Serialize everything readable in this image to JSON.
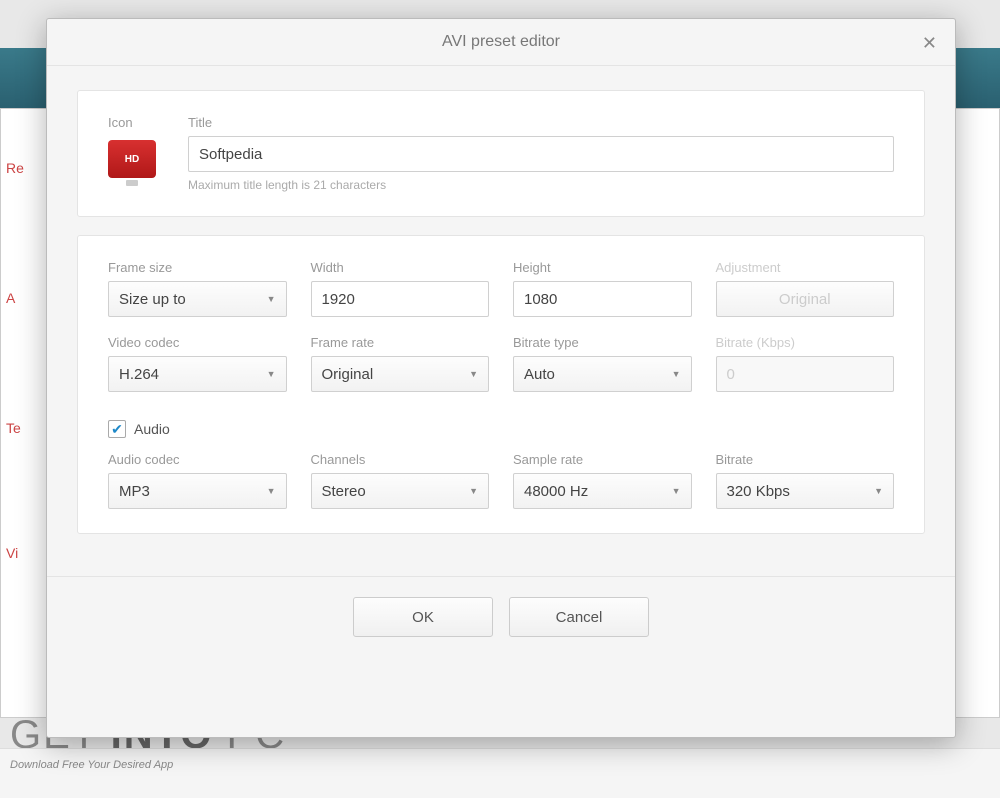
{
  "dialog": {
    "title": "AVI preset editor",
    "icon_label": "Icon",
    "icon_badge": "HD",
    "title_label": "Title",
    "title_value": "Softpedia",
    "title_hint": "Maximum title length is 21 characters"
  },
  "video": {
    "frame_size_label": "Frame size",
    "frame_size_value": "Size up to",
    "width_label": "Width",
    "width_value": "1920",
    "height_label": "Height",
    "height_value": "1080",
    "adjustment_label": "Adjustment",
    "adjustment_value": "Original",
    "codec_label": "Video codec",
    "codec_value": "H.264",
    "framerate_label": "Frame rate",
    "framerate_value": "Original",
    "bitratetype_label": "Bitrate type",
    "bitratetype_value": "Auto",
    "bitrate_label": "Bitrate (Kbps)",
    "bitrate_value": "0"
  },
  "audio": {
    "checkbox_label": "Audio",
    "checked": true,
    "codec_label": "Audio codec",
    "codec_value": "MP3",
    "channels_label": "Channels",
    "channels_value": "Stereo",
    "samplerate_label": "Sample rate",
    "samplerate_value": "48000 Hz",
    "bitrate_label": "Bitrate",
    "bitrate_value": "320 Kbps"
  },
  "buttons": {
    "ok": "OK",
    "cancel": "Cancel"
  },
  "background": {
    "side": {
      "r": "Re",
      "a": "A",
      "t": "Te",
      "v": "Vi"
    },
    "watermark_pre": "GET ",
    "watermark_bold": "INTO",
    "watermark_post": " PC",
    "tagline": "Download Free Your Desired App"
  }
}
